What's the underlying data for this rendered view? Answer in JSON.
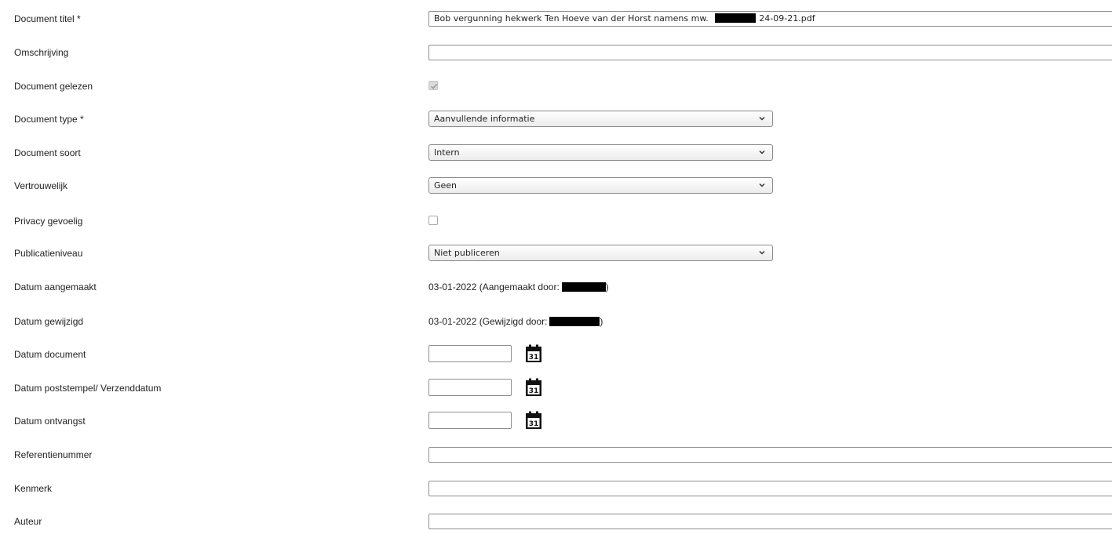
{
  "form": {
    "document_titel": {
      "label": "Document titel *",
      "value_prefix": "Bob vergunning hekwerk Ten Hoeve  van der Horst namens mw.",
      "value_suffix": "24-09-21.pdf"
    },
    "omschrijving": {
      "label": "Omschrijving",
      "value": ""
    },
    "document_gelezen": {
      "label": "Document gelezen",
      "checked": true
    },
    "document_type": {
      "label": "Document type *",
      "selected": "Aanvullende informatie"
    },
    "document_soort": {
      "label": "Document soort",
      "selected": "Intern"
    },
    "vertrouwelijk": {
      "label": "Vertrouwelijk",
      "selected": "Geen"
    },
    "privacy_gevoelig": {
      "label": "Privacy gevoelig",
      "checked": false
    },
    "publicatieniveau": {
      "label": "Publicatieniveau",
      "selected": "Niet publiceren"
    },
    "datum_aangemaakt": {
      "label": "Datum aangemaakt",
      "value_prefix": "03-01-2022 (Aangemaakt door:",
      "value_suffix": ")"
    },
    "datum_gewijzigd": {
      "label": "Datum gewijzigd",
      "value_prefix": "03-01-2022 (Gewijzigd door:",
      "value_suffix": ")"
    },
    "datum_document": {
      "label": "Datum document",
      "value": ""
    },
    "datum_poststempel": {
      "label": "Datum poststempel/ Verzenddatum",
      "value": ""
    },
    "datum_ontvangst": {
      "label": "Datum ontvangst",
      "value": ""
    },
    "referentienummer": {
      "label": "Referentienummer",
      "value": ""
    },
    "kenmerk": {
      "label": "Kenmerk",
      "value": ""
    },
    "auteur": {
      "label": "Auteur",
      "value": ""
    }
  },
  "icons": {
    "calendar": "calendar-icon",
    "dropdown": "chevron-down-icon",
    "checkmark": "checkmark-icon"
  },
  "calendar_day": "31"
}
